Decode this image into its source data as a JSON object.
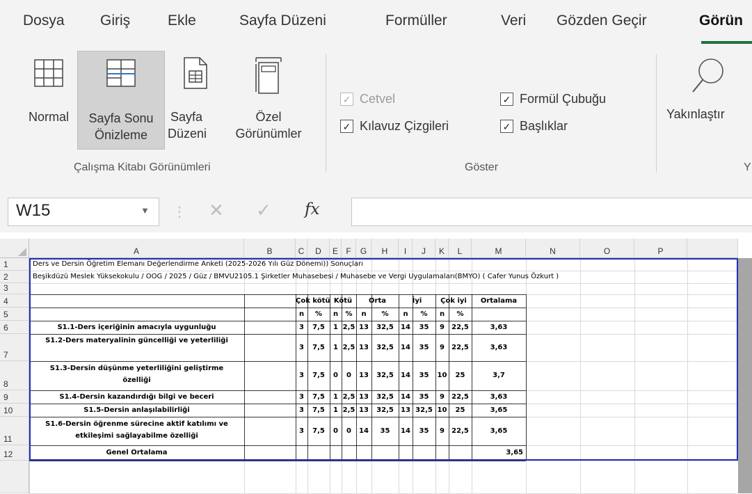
{
  "ribbon": {
    "tabs": [
      "Dosya",
      "Giriş",
      "Ekle",
      "Sayfa Düzeni",
      "Formüller",
      "Veri",
      "Gözden Geçir",
      "Görün"
    ],
    "active_tab": "Görün",
    "views": {
      "normal": "Normal",
      "page_break_1": "Sayfa Sonu",
      "page_break_2": "Önizleme",
      "page_layout_1": "Sayfa",
      "page_layout_2": "Düzeni",
      "custom_1": "Özel",
      "custom_2": "Görünümler",
      "group_label": "Çalışma Kitabı Görünümleri"
    },
    "show": {
      "ruler": "Cetvel",
      "formula_bar": "Formül Çubuğu",
      "gridlines": "Kılavuz Çizgileri",
      "headings": "Başlıklar",
      "group_label": "Göster"
    },
    "zoom": {
      "label": "Yakınlaştır",
      "group_label_partial": "Y"
    }
  },
  "formula_bar": {
    "name_box": "W15",
    "fx": "fx",
    "value": ""
  },
  "columns": [
    "A",
    "B",
    "C",
    "D",
    "E",
    "F",
    "G",
    "H",
    "I",
    "J",
    "K",
    "L",
    "M",
    "N",
    "O",
    "P"
  ],
  "rows": [
    "1",
    "2",
    "3",
    "4",
    "5",
    "6",
    "7",
    "8",
    "9",
    "10",
    "11",
    "12"
  ],
  "sheet": {
    "title1": "Ders ve Dersin Öğretim Elemanı Değerlendirme Anketi (2025-2026 Yılı Güz Dönemi)) Sonuçları",
    "title2": "Beşikdüzü Meslek Yüksekokulu / OOG / 2025 / Güz / BMVU2105.1 Şirketler Muhasebesi / Muhasebe ve Vergi Uygulamaları(BMYO) ( Cafer Yunus Özkurt )",
    "groups": [
      "Çok kötü",
      "Kötü",
      "Orta",
      "İyi",
      "Çok iyi",
      "Ortalama"
    ],
    "subheaders": [
      "n",
      "%",
      "n",
      "%",
      "n",
      "%",
      "n",
      "%",
      "n",
      "%"
    ],
    "items": [
      {
        "label": "S1.1-Ders içeriğinin amacıyla uygunluğu",
        "values": [
          "3",
          "7,5",
          "1",
          "2,5",
          "13",
          "32,5",
          "14",
          "35",
          "9",
          "22,5"
        ],
        "avg": "3,63"
      },
      {
        "label": "S1.2-Ders materyalinin güncelliği ve yeterliliği",
        "values": [
          "3",
          "7,5",
          "1",
          "2,5",
          "13",
          "32,5",
          "14",
          "35",
          "9",
          "22,5"
        ],
        "avg": "3,63"
      },
      {
        "label1": "S1.3-Dersin düşünme yeterliliğini geliştirme",
        "label2": "özelliği",
        "values": [
          "3",
          "7,5",
          "0",
          "0",
          "13",
          "32,5",
          "14",
          "35",
          "10",
          "25"
        ],
        "avg": "3,7"
      },
      {
        "label": "S1.4-Dersin kazandırdığı bilgi ve beceri",
        "values": [
          "3",
          "7,5",
          "1",
          "2,5",
          "13",
          "32,5",
          "14",
          "35",
          "9",
          "22,5"
        ],
        "avg": "3,63"
      },
      {
        "label": "S1.5-Dersin anlaşılabilirliği",
        "values": [
          "3",
          "7,5",
          "1",
          "2,5",
          "13",
          "32,5",
          "13",
          "32,5",
          "10",
          "25"
        ],
        "avg": "3,65"
      },
      {
        "label1": "S1.6-Dersin öğrenme sürecine aktif katılımı ve",
        "label2": "etkileşimi sağlayabilme özelliği",
        "values": [
          "3",
          "7,5",
          "0",
          "0",
          "14",
          "35",
          "14",
          "35",
          "9",
          "22,5"
        ],
        "avg": "3,65"
      }
    ],
    "general_label": "Genel Ortalama",
    "general_avg": "3,65"
  },
  "colors": {
    "accent": "#1e7145",
    "border_blue": "#1f2fbf",
    "ribbon_bg": "#f3f3f3"
  }
}
